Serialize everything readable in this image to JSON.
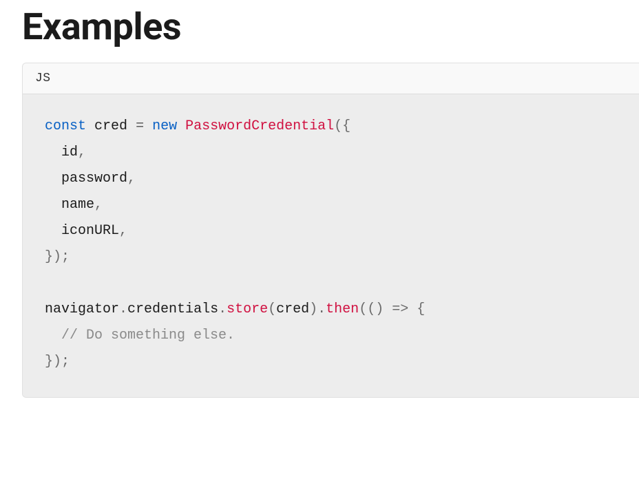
{
  "heading": "Examples",
  "code": {
    "language_label": "JS",
    "tokens": {
      "const_kw": "const",
      "cred_var": "cred",
      "equals": "=",
      "new_kw": "new",
      "class_name": "PasswordCredential",
      "open_paren_brace": "({",
      "prop_id": "id",
      "prop_password": "password",
      "prop_name": "name",
      "prop_iconURL": "iconURL",
      "comma": ",",
      "close_brace_paren_semi": "});",
      "navigator": "navigator",
      "dot": ".",
      "credentials": "credentials",
      "store": "store",
      "open_paren": "(",
      "close_paren": ")",
      "then": "then",
      "arrow_params": "(()",
      "arrow": "=>",
      "open_brace": "{",
      "comment": "// Do something else.",
      "close_brace_paren_semi2": "});"
    }
  }
}
